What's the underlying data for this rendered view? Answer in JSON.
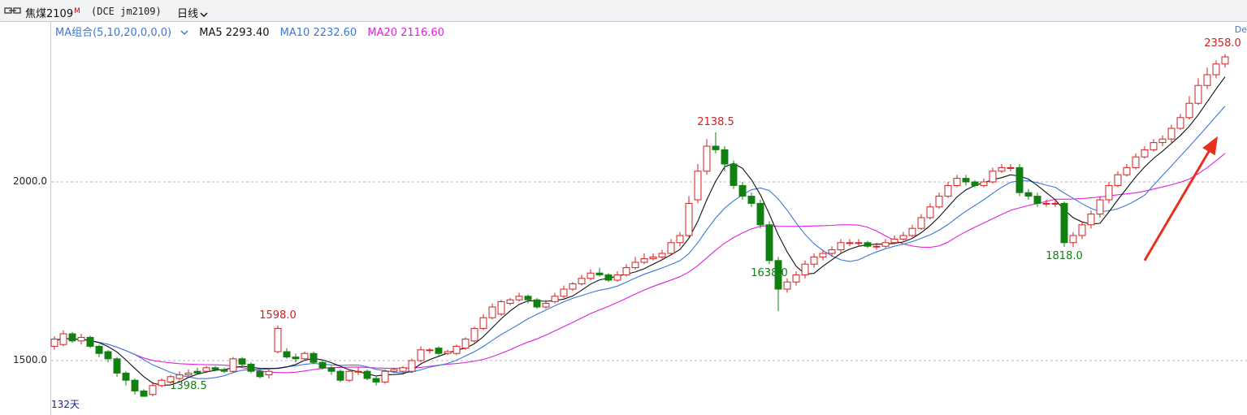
{
  "header": {
    "symbol": "焦煤2109",
    "symbol_superscript": "M",
    "exchange": "(DCE jm2109)",
    "period": "日线",
    "period_dropdown_icon": "chevron-down-icon",
    "left_icon": "link-icon"
  },
  "legend": {
    "combo": "MA组合(5,10,20,0,0,0)",
    "ma5": "MA5 2293.40",
    "ma10": "MA10 2232.60",
    "ma20": "MA20 2116.60"
  },
  "footer": {
    "days": "132天",
    "corner_text": "De"
  },
  "colors": {
    "up": "#d02020",
    "down": "#108010",
    "ma5": "#111111",
    "ma10": "#3a78d8",
    "ma20": "#e020e0",
    "arrow": "#e83020"
  },
  "chart_data": {
    "type": "candlestick",
    "y_ticks": [
      "2000.0",
      "1500.0"
    ],
    "y_tick_values": [
      2000,
      1500
    ],
    "ylim": [
      1360,
      2390
    ],
    "gridlines": "dashed at y ticks",
    "annotations": [
      {
        "text": "1398.5",
        "value": 1398.5,
        "index": 15,
        "kind": "low"
      },
      {
        "text": "1598.0",
        "value": 1598.0,
        "index": 25,
        "kind": "high"
      },
      {
        "text": "2138.5",
        "value": 2138.5,
        "index": 74,
        "kind": "high"
      },
      {
        "text": "1638.0",
        "value": 1638.0,
        "index": 80,
        "kind": "low"
      },
      {
        "text": "1818.0",
        "value": 1818.0,
        "index": 113,
        "kind": "low"
      },
      {
        "text": "2358.0",
        "value": 2358.0,
        "index": 131,
        "kind": "high"
      }
    ],
    "trend_arrow": {
      "from_index": 122,
      "from_value": 1780,
      "to_index": 130,
      "to_value": 2120
    },
    "closes": [
      1555,
      1570,
      1555,
      1560,
      1540,
      1525,
      1515,
      1480,
      1450,
      1420,
      1410,
      1425,
      1450,
      1455,
      1460,
      1475,
      1470,
      1480,
      1480,
      1470,
      1500,
      1490,
      1470,
      1460,
      1470,
      1500,
      1510,
      1505,
      1520,
      1495,
      1480,
      1470,
      1455,
      1470,
      1470,
      1450,
      1440,
      1470,
      1475,
      1480,
      1500,
      1530,
      1530,
      1520,
      1525,
      1540,
      1560,
      1590,
      1620,
      1650,
      1665,
      1670,
      1680,
      1670,
      1650,
      1660,
      1680,
      1700,
      1715,
      1730,
      1745,
      1740,
      1725,
      1740,
      1760,
      1775,
      1785,
      1790,
      1800,
      1830,
      1850,
      1940,
      2030,
      2100,
      2090,
      2050,
      1990,
      1960,
      1940,
      1880,
      1780,
      1700,
      1720,
      1740,
      1770,
      1790,
      1800,
      1810,
      1830,
      1830,
      1830,
      1820,
      1820,
      1830,
      1840,
      1850,
      1870,
      1900,
      1930,
      1960,
      1990,
      2010,
      2000,
      1990,
      2000,
      2030,
      2040,
      2040,
      1970,
      1960,
      1940,
      1940,
      1940,
      1830,
      1850,
      1880,
      1910,
      1950,
      1990,
      2020,
      2040,
      2070,
      2090,
      2110,
      2120,
      2150,
      2180,
      2220,
      2270,
      2300,
      2330,
      2350
    ],
    "candles": [
      [
        1540,
        1560,
        1530,
        1568
      ],
      [
        1545,
        1575,
        1540,
        1585
      ],
      [
        1575,
        1555,
        1550,
        1580
      ],
      [
        1555,
        1565,
        1545,
        1575
      ],
      [
        1565,
        1540,
        1535,
        1570
      ],
      [
        1540,
        1520,
        1510,
        1545
      ],
      [
        1525,
        1505,
        1495,
        1530
      ],
      [
        1505,
        1465,
        1455,
        1510
      ],
      [
        1465,
        1445,
        1430,
        1470
      ],
      [
        1445,
        1415,
        1405,
        1450
      ],
      [
        1415,
        1400,
        1398.5,
        1420
      ],
      [
        1405,
        1430,
        1400,
        1440
      ],
      [
        1430,
        1445,
        1425,
        1450
      ],
      [
        1440,
        1455,
        1435,
        1460
      ],
      [
        1450,
        1460,
        1445,
        1470
      ],
      [
        1460,
        1465,
        1455,
        1475
      ],
      [
        1470,
        1465,
        1460,
        1480
      ],
      [
        1470,
        1480,
        1465,
        1485
      ],
      [
        1480,
        1475,
        1470,
        1485
      ],
      [
        1475,
        1470,
        1465,
        1480
      ],
      [
        1470,
        1505,
        1465,
        1510
      ],
      [
        1505,
        1490,
        1480,
        1510
      ],
      [
        1490,
        1470,
        1465,
        1495
      ],
      [
        1470,
        1455,
        1450,
        1480
      ],
      [
        1460,
        1470,
        1450,
        1480
      ],
      [
        1525,
        1590,
        1520,
        1598
      ],
      [
        1525,
        1510,
        1505,
        1535
      ],
      [
        1510,
        1505,
        1495,
        1520
      ],
      [
        1505,
        1520,
        1500,
        1525
      ],
      [
        1520,
        1495,
        1490,
        1525
      ],
      [
        1495,
        1480,
        1475,
        1500
      ],
      [
        1480,
        1470,
        1460,
        1485
      ],
      [
        1470,
        1445,
        1440,
        1475
      ],
      [
        1445,
        1470,
        1440,
        1475
      ],
      [
        1470,
        1470,
        1460,
        1480
      ],
      [
        1470,
        1450,
        1445,
        1475
      ],
      [
        1450,
        1440,
        1430,
        1455
      ],
      [
        1440,
        1470,
        1435,
        1475
      ],
      [
        1470,
        1475,
        1465,
        1480
      ],
      [
        1470,
        1480,
        1465,
        1485
      ],
      [
        1470,
        1500,
        1465,
        1505
      ],
      [
        1500,
        1530,
        1495,
        1540
      ],
      [
        1530,
        1530,
        1520,
        1535
      ],
      [
        1535,
        1520,
        1515,
        1540
      ],
      [
        1520,
        1525,
        1515,
        1530
      ],
      [
        1520,
        1540,
        1515,
        1545
      ],
      [
        1535,
        1560,
        1530,
        1565
      ],
      [
        1555,
        1590,
        1550,
        1595
      ],
      [
        1590,
        1620,
        1585,
        1630
      ],
      [
        1620,
        1650,
        1615,
        1660
      ],
      [
        1630,
        1665,
        1625,
        1670
      ],
      [
        1660,
        1670,
        1655,
        1675
      ],
      [
        1670,
        1680,
        1665,
        1690
      ],
      [
        1680,
        1670,
        1660,
        1685
      ],
      [
        1670,
        1650,
        1645,
        1675
      ],
      [
        1650,
        1660,
        1645,
        1670
      ],
      [
        1665,
        1680,
        1660,
        1690
      ],
      [
        1680,
        1700,
        1675,
        1710
      ],
      [
        1700,
        1715,
        1695,
        1720
      ],
      [
        1715,
        1730,
        1710,
        1740
      ],
      [
        1730,
        1745,
        1725,
        1755
      ],
      [
        1745,
        1740,
        1735,
        1760
      ],
      [
        1740,
        1725,
        1720,
        1745
      ],
      [
        1725,
        1740,
        1720,
        1750
      ],
      [
        1740,
        1760,
        1735,
        1770
      ],
      [
        1760,
        1775,
        1755,
        1790
      ],
      [
        1775,
        1785,
        1770,
        1800
      ],
      [
        1785,
        1790,
        1780,
        1800
      ],
      [
        1790,
        1800,
        1785,
        1810
      ],
      [
        1800,
        1830,
        1795,
        1840
      ],
      [
        1830,
        1850,
        1820,
        1860
      ],
      [
        1850,
        1940,
        1845,
        1960
      ],
      [
        1950,
        2030,
        1940,
        2050
      ],
      [
        2030,
        2100,
        2020,
        2120
      ],
      [
        2100,
        2090,
        2080,
        2138.5
      ],
      [
        2090,
        2050,
        2030,
        2100
      ],
      [
        2050,
        1990,
        1980,
        2060
      ],
      [
        1990,
        1960,
        1950,
        2000
      ],
      [
        1960,
        1940,
        1930,
        1970
      ],
      [
        1940,
        1880,
        1870,
        1950
      ],
      [
        1880,
        1780,
        1770,
        1890
      ],
      [
        1780,
        1700,
        1638,
        1790
      ],
      [
        1700,
        1720,
        1690,
        1730
      ],
      [
        1720,
        1740,
        1710,
        1750
      ],
      [
        1740,
        1770,
        1730,
        1780
      ],
      [
        1770,
        1790,
        1760,
        1800
      ],
      [
        1790,
        1800,
        1780,
        1810
      ],
      [
        1800,
        1810,
        1790,
        1820
      ],
      [
        1810,
        1830,
        1800,
        1840
      ],
      [
        1830,
        1830,
        1820,
        1840
      ],
      [
        1830,
        1830,
        1820,
        1840
      ],
      [
        1830,
        1820,
        1815,
        1835
      ],
      [
        1820,
        1820,
        1810,
        1830
      ],
      [
        1820,
        1830,
        1815,
        1840
      ],
      [
        1830,
        1840,
        1825,
        1850
      ],
      [
        1840,
        1850,
        1835,
        1860
      ],
      [
        1850,
        1870,
        1845,
        1880
      ],
      [
        1870,
        1900,
        1865,
        1910
      ],
      [
        1900,
        1930,
        1895,
        1940
      ],
      [
        1930,
        1960,
        1925,
        1970
      ],
      [
        1960,
        1990,
        1955,
        2000
      ],
      [
        1990,
        2010,
        1985,
        2020
      ],
      [
        2010,
        2000,
        1990,
        2020
      ],
      [
        2000,
        1990,
        1985,
        2005
      ],
      [
        1990,
        2000,
        1985,
        2010
      ],
      [
        2000,
        2030,
        1995,
        2040
      ],
      [
        2030,
        2040,
        2025,
        2050
      ],
      [
        2040,
        2040,
        2030,
        2050
      ],
      [
        2040,
        1970,
        1960,
        2050
      ],
      [
        1970,
        1960,
        1950,
        1980
      ],
      [
        1960,
        1940,
        1930,
        1970
      ],
      [
        1940,
        1940,
        1930,
        1950
      ],
      [
        1940,
        1940,
        1930,
        1950
      ],
      [
        1940,
        1830,
        1818,
        1945
      ],
      [
        1830,
        1850,
        1818,
        1860
      ],
      [
        1850,
        1880,
        1840,
        1890
      ],
      [
        1880,
        1910,
        1870,
        1920
      ],
      [
        1910,
        1950,
        1900,
        1960
      ],
      [
        1950,
        1990,
        1940,
        2000
      ],
      [
        1990,
        2020,
        1985,
        2030
      ],
      [
        2020,
        2040,
        2015,
        2050
      ],
      [
        2040,
        2070,
        2035,
        2080
      ],
      [
        2070,
        2090,
        2065,
        2100
      ],
      [
        2090,
        2110,
        2085,
        2120
      ],
      [
        2110,
        2120,
        2100,
        2130
      ],
      [
        2120,
        2150,
        2110,
        2160
      ],
      [
        2150,
        2180,
        2145,
        2190
      ],
      [
        2180,
        2220,
        2175,
        2240
      ],
      [
        2220,
        2270,
        2215,
        2290
      ],
      [
        2270,
        2300,
        2260,
        2320
      ],
      [
        2300,
        2330,
        2290,
        2340
      ],
      [
        2330,
        2350,
        2320,
        2358
      ]
    ]
  }
}
